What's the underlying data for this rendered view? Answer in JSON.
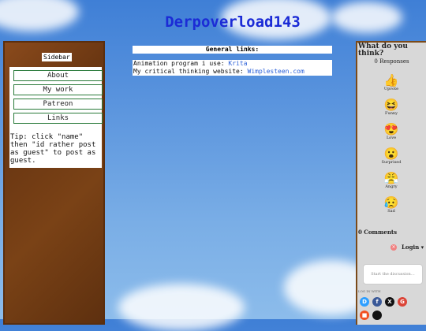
{
  "site": {
    "title": "Derpoverload143"
  },
  "sidebar": {
    "title": "Sidebar",
    "nav": [
      {
        "label": "About"
      },
      {
        "label": "My work"
      },
      {
        "label": "Patreon"
      },
      {
        "label": "Links"
      }
    ],
    "tip": "Tip: click \"name\" then \"id rather post as guest\" to post as guest."
  },
  "main": {
    "header": "General links:",
    "animation_label": "Animation program i use:",
    "animation_link": "Krita",
    "website_label": "My critical thinking website:",
    "website_link": "Wimplesteen.com"
  },
  "comments": {
    "question": "What do you think?",
    "responses": "0 Responses",
    "reactions": [
      {
        "label": "Upvote",
        "icon": "thumbs-up-icon",
        "glyph": "👍"
      },
      {
        "label": "Funny",
        "icon": "laughing-face-icon",
        "glyph": "😆"
      },
      {
        "label": "Love",
        "icon": "heart-eyes-icon",
        "glyph": "😍"
      },
      {
        "label": "Surprised",
        "icon": "surprised-face-icon",
        "glyph": "😮"
      },
      {
        "label": "Angry",
        "icon": "angry-face-icon",
        "glyph": "😤"
      },
      {
        "label": "Sad",
        "icon": "sad-face-icon",
        "glyph": "😥"
      }
    ],
    "count": "0 Comments",
    "notify": "×",
    "login": "Login ▾",
    "placeholder": "Start the discussion…",
    "login_with": "LOG IN WITH",
    "social": [
      {
        "name": "disqus",
        "glyph": "D",
        "color": "#2e9fff"
      },
      {
        "name": "facebook",
        "glyph": "f",
        "color": "#3b5998"
      },
      {
        "name": "x",
        "glyph": "X",
        "color": "#111111"
      },
      {
        "name": "google",
        "glyph": "G",
        "color": "#db4437"
      },
      {
        "name": "microsoft",
        "glyph": "■",
        "color": "#f25022"
      },
      {
        "name": "apple",
        "glyph": "",
        "color": "#111111"
      }
    ]
  }
}
